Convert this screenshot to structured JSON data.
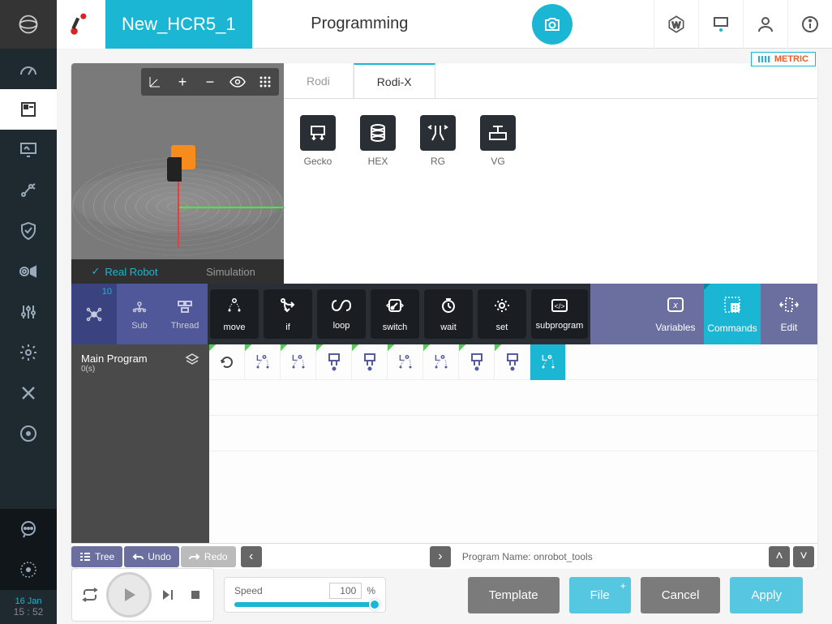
{
  "header": {
    "project_name": "New_HCR5_1",
    "page_title": "Programming",
    "metric_label": "METRIC"
  },
  "viewport": {
    "tabs": {
      "real": "Real Robot",
      "sim": "Simulation"
    }
  },
  "component_tabs": {
    "rodi": "Rodi",
    "rodix": "Rodi-X"
  },
  "components": {
    "gecko": "Gecko",
    "hex": "HEX",
    "rg": "RG",
    "vg": "VG"
  },
  "cmd_left": {
    "badge": "10",
    "sub": "Sub",
    "thread": "Thread"
  },
  "commands": {
    "move": "move",
    "if": "if",
    "loop": "loop",
    "switch": "switch",
    "wait": "wait",
    "set": "set",
    "subprogram": "subprogram"
  },
  "cmd_right": {
    "variables": "Variables",
    "commands": "Commands",
    "edit": "Edit"
  },
  "program": {
    "title": "Main Program",
    "duration": "0(s)",
    "name_label": "Program Name:",
    "name_value": "onrobot_tools"
  },
  "footer": {
    "tree": "Tree",
    "undo": "Undo",
    "redo": "Redo"
  },
  "playback": {
    "speed_label": "Speed",
    "speed_value": "100",
    "speed_unit": "%"
  },
  "actions": {
    "template": "Template",
    "file": "File",
    "cancel": "Cancel",
    "apply": "Apply"
  },
  "status": {
    "date": "16 Jan",
    "time": "15 : 52"
  }
}
